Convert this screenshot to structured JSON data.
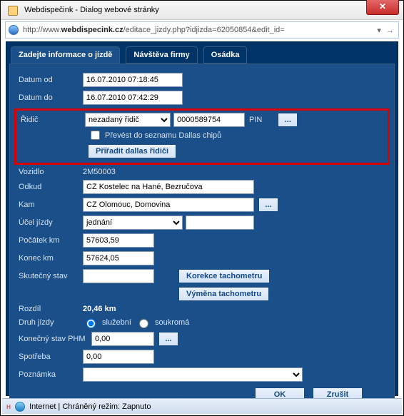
{
  "window": {
    "title": "Webdispečink - Dialog webové stránky"
  },
  "addressbar": {
    "prefix": "http://www.",
    "host": "webdispecink.cz",
    "path": "/editace_jizdy.php?idjizda=62050854&edit_id="
  },
  "tabs": {
    "t1": "Zadejte informace o jízdě",
    "t2": "Návštěva firmy",
    "t3": "Osádka"
  },
  "labels": {
    "datum_od": "Datum od",
    "datum_do": "Datum do",
    "ridic": "Řidič",
    "prevest": "Převést do seznamu Dallas chipů",
    "priradit": "Přiřadit dallas řidiči",
    "pin": "PIN",
    "vozidlo": "Vozidlo",
    "odkud": "Odkud",
    "kam": "Kam",
    "ucel": "Účel jízdy",
    "pocatek": "Počátek km",
    "konec": "Konec km",
    "skutecny": "Skutečný stav",
    "korekce": "Korekce tachometru",
    "vymena": "Výměna tachometru",
    "rozdil": "Rozdíl",
    "druh": "Druh jízdy",
    "sluzebni": "služební",
    "soukroma": "soukromá",
    "konecny_phm": "Konečný stav PHM",
    "spotreba": "Spotřeba",
    "poznamka": "Poznámka",
    "ok": "OK",
    "zrusit": "Zrušit"
  },
  "values": {
    "datum_od": "16.07.2010 07:18:45",
    "datum_do": "16.07.2010 07:42:29",
    "ridic": "nezadaný řidič",
    "dallas_id": "0000589754",
    "vozidlo": "2M50003",
    "odkud": "CZ Kostelec na Hané, Bezručova",
    "kam": "CZ Olomouc, Domovina",
    "ucel": "jednání",
    "pocatek": "57603,59",
    "konec": "57624,05",
    "skutecny": "",
    "rozdil": "20,46 km",
    "konecny_phm": "0,00",
    "spotreba": "0,00",
    "poznamka": "",
    "purpose_text": ""
  },
  "status": {
    "text": "Internet | Chráněný režim: Zapnuto"
  }
}
